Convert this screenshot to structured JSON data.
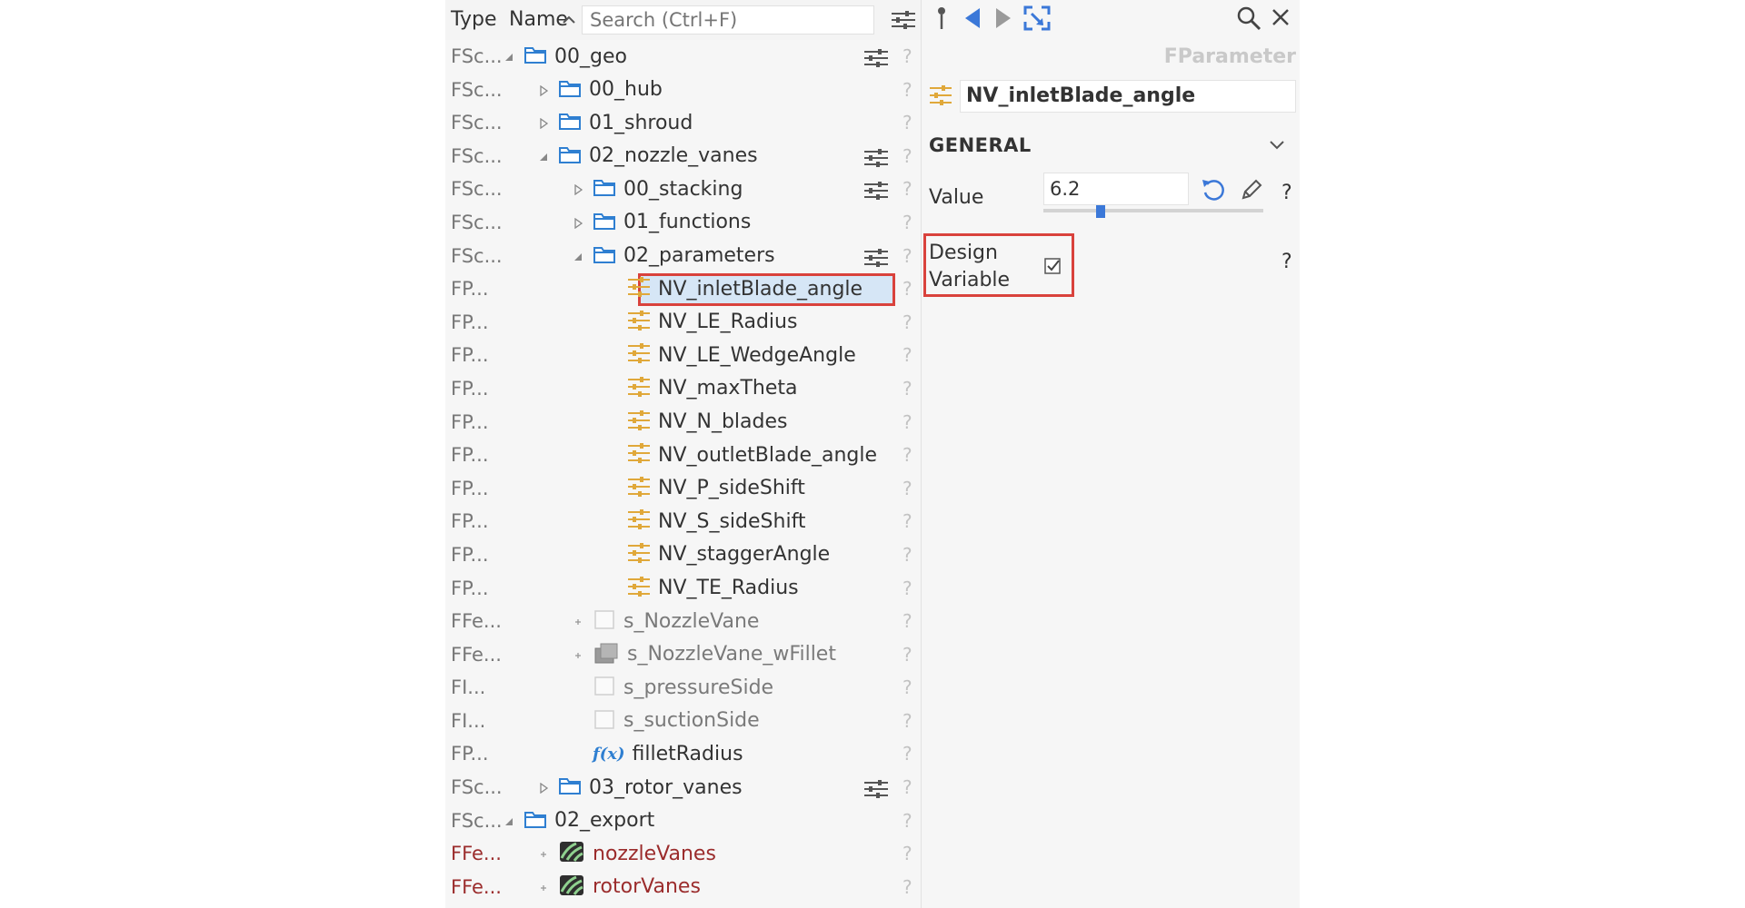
{
  "tree": {
    "header": {
      "type_col": "Type",
      "name_col": "Name",
      "search_placeholder": "Search (Ctrl+F)"
    },
    "rows": [
      {
        "type": "FSc...",
        "label": "00_geo",
        "indent": 0,
        "expander": "open",
        "icon": "folder",
        "filter": true
      },
      {
        "type": "FSc...",
        "label": "00_hub",
        "indent": 1,
        "expander": "closed",
        "icon": "folder",
        "filter": false
      },
      {
        "type": "FSc...",
        "label": "01_shroud",
        "indent": 1,
        "expander": "closed",
        "icon": "folder",
        "filter": false
      },
      {
        "type": "FSc...",
        "label": "02_nozzle_vanes",
        "indent": 1,
        "expander": "open",
        "icon": "folder",
        "filter": true
      },
      {
        "type": "FSc...",
        "label": "00_stacking",
        "indent": 2,
        "expander": "closed",
        "icon": "folder",
        "filter": true
      },
      {
        "type": "FSc...",
        "label": "01_functions",
        "indent": 2,
        "expander": "closed",
        "icon": "folder",
        "filter": false
      },
      {
        "type": "FSc...",
        "label": "02_parameters",
        "indent": 2,
        "expander": "open",
        "icon": "folder",
        "filter": true
      },
      {
        "type": "FP...",
        "label": "NV_inletBlade_angle",
        "indent": 3,
        "expander": "none",
        "icon": "param",
        "filter": false,
        "selected": true
      },
      {
        "type": "FP...",
        "label": "NV_LE_Radius",
        "indent": 3,
        "expander": "none",
        "icon": "param",
        "filter": false
      },
      {
        "type": "FP...",
        "label": "NV_LE_WedgeAngle",
        "indent": 3,
        "expander": "none",
        "icon": "param",
        "filter": false
      },
      {
        "type": "FP...",
        "label": "NV_maxTheta",
        "indent": 3,
        "expander": "none",
        "icon": "param",
        "filter": false
      },
      {
        "type": "FP...",
        "label": "NV_N_blades",
        "indent": 3,
        "expander": "none",
        "icon": "param",
        "filter": false
      },
      {
        "type": "FP...",
        "label": "NV_outletBlade_angle",
        "indent": 3,
        "expander": "none",
        "icon": "param",
        "filter": false
      },
      {
        "type": "FP...",
        "label": "NV_P_sideShift",
        "indent": 3,
        "expander": "none",
        "icon": "param",
        "filter": false
      },
      {
        "type": "FP...",
        "label": "NV_S_sideShift",
        "indent": 3,
        "expander": "none",
        "icon": "param",
        "filter": false
      },
      {
        "type": "FP...",
        "label": "NV_staggerAngle",
        "indent": 3,
        "expander": "none",
        "icon": "param",
        "filter": false
      },
      {
        "type": "FP...",
        "label": "NV_TE_Radius",
        "indent": 3,
        "expander": "none",
        "icon": "param",
        "filter": false
      },
      {
        "type": "FFe...",
        "label": "s_NozzleVane",
        "indent": 2,
        "expander": "plus",
        "icon": "surface",
        "filter": false,
        "gray": true
      },
      {
        "type": "FFe...",
        "label": "s_NozzleVane_wFillet",
        "indent": 2,
        "expander": "plus",
        "icon": "solid",
        "filter": false,
        "gray": true
      },
      {
        "type": "FI...",
        "label": "s_pressureSide",
        "indent": 2,
        "expander": "none",
        "icon": "surface",
        "filter": false,
        "gray": true
      },
      {
        "type": "FI...",
        "label": "s_suctionSide",
        "indent": 2,
        "expander": "none",
        "icon": "surface",
        "filter": false,
        "gray": true
      },
      {
        "type": "FP...",
        "label": "filletRadius",
        "indent": 2,
        "expander": "none",
        "icon": "function",
        "filter": false
      },
      {
        "type": "FSc...",
        "label": "03_rotor_vanes",
        "indent": 1,
        "expander": "closed",
        "icon": "folder",
        "filter": true
      },
      {
        "type": "FSc...",
        "label": "02_export",
        "indent": 0,
        "expander": "open",
        "icon": "folder",
        "filter": false
      },
      {
        "type": "FFe...",
        "label": "nozzleVanes",
        "indent": 1,
        "expander": "plus",
        "icon": "export",
        "filter": false,
        "red": true
      },
      {
        "type": "FFe...",
        "label": "rotorVanes",
        "indent": 1,
        "expander": "plus",
        "icon": "export",
        "filter": false,
        "red": true
      }
    ],
    "help_glyph": "?",
    "function_glyph": "f(x)"
  },
  "props": {
    "class_name": "FParameter",
    "object_name": "NV_inletBlade_angle",
    "section_title": "GENERAL",
    "value_label": "Value",
    "value": "6.2",
    "slider_fraction": 0.26,
    "help_glyph": "?",
    "design_variable_label": "Design Variable",
    "design_variable_checked": true
  },
  "colors": {
    "accent_blue": "#3b78d8",
    "folder_blue": "#2f7fd1",
    "param_orange": "#e0a83a",
    "highlight_red": "#d9423c",
    "selection_bg": "#d6e6f6"
  }
}
